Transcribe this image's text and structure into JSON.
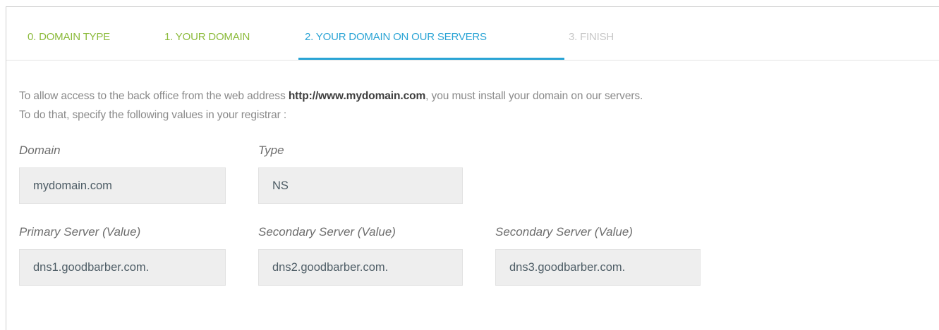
{
  "tabs": [
    {
      "label": "0. DOMAIN TYPE",
      "state": "done"
    },
    {
      "label": "1. YOUR DOMAIN",
      "state": "done"
    },
    {
      "label": "2. YOUR DOMAIN ON OUR SERVERS",
      "state": "active"
    },
    {
      "label": "3. FINISH",
      "state": "pending"
    }
  ],
  "intro": {
    "line1_prefix": "To allow access to the back office from the web address ",
    "line1_url": "http://www.mydomain.com",
    "line1_suffix": ", you must install your domain on our servers.",
    "line2": "To do that, specify the following values in your registrar :"
  },
  "fields": {
    "domain": {
      "label": "Domain",
      "value": "mydomain.com"
    },
    "type": {
      "label": "Type",
      "value": "NS"
    },
    "primary": {
      "label": "Primary Server (Value)",
      "value": "dns1.goodbarber.com."
    },
    "secondary1": {
      "label": "Secondary Server (Value)",
      "value": "dns2.goodbarber.com."
    },
    "secondary2": {
      "label": "Secondary Server (Value)",
      "value": "dns3.goodbarber.com."
    }
  },
  "colors": {
    "tab_done": "#8cbb3c",
    "tab_active": "#2aa4d5",
    "tab_pending": "#c7c7c7",
    "field_bg": "#eeeeee"
  }
}
